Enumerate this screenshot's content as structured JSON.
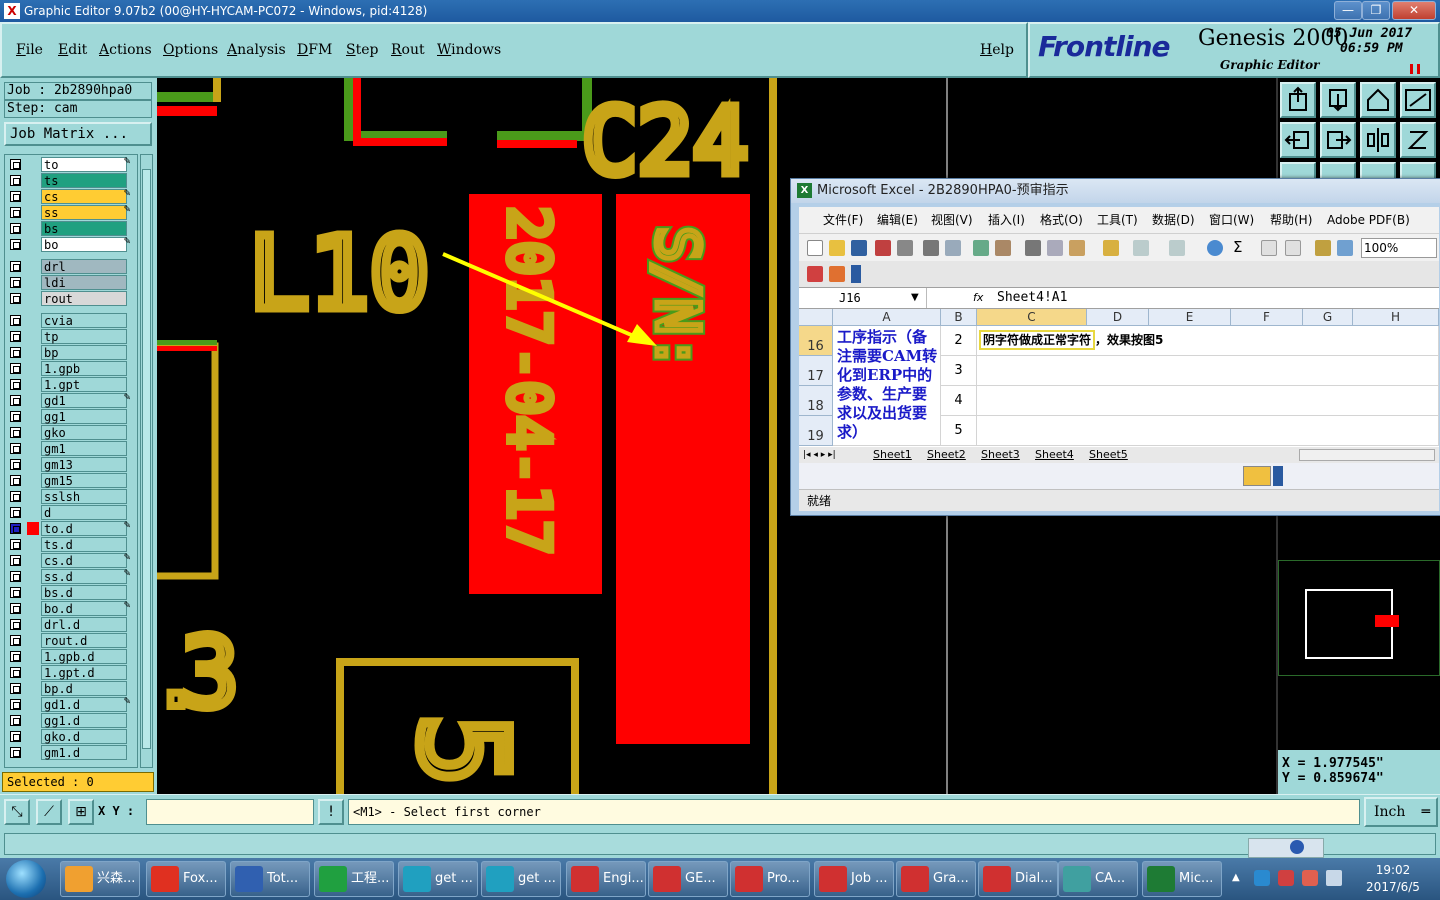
{
  "window": {
    "title": "Graphic Editor 9.07b2 (00@HY-HYCAM-PC072 - Windows, pid:4128)",
    "minimize": "—",
    "maximize": "❐",
    "close": "✕"
  },
  "menu": {
    "items": [
      "File",
      "Edit",
      "Actions",
      "Options",
      "Analysis",
      "DFM",
      "Step",
      "Rout",
      "Windows"
    ],
    "help": "Help"
  },
  "brand": {
    "logo": "Frontline",
    "product": "Genesis 2000",
    "module": "Graphic Editor",
    "date": "05 Jun 2017",
    "time": "06:59 PM"
  },
  "left": {
    "job": "Job : 2b2890hpa0",
    "step": "Step: cam",
    "job_matrix": "Job Matrix ...",
    "selected": "Selected : 0",
    "layers": [
      {
        "name": "to",
        "bg": "#ffffff",
        "lock": true
      },
      {
        "name": "ts",
        "bg": "#20a080",
        "lock": false
      },
      {
        "name": "cs",
        "bg": "#ffcc33",
        "lock": true
      },
      {
        "name": "ss",
        "bg": "#ffcc33",
        "lock": true
      },
      {
        "name": "bs",
        "bg": "#20a080",
        "lock": false
      },
      {
        "name": "bo",
        "bg": "#ffffff",
        "lock": true
      },
      {
        "name": "drl",
        "bg": "#a0b8c0",
        "lock": false,
        "gap": true
      },
      {
        "name": "ldi",
        "bg": "#a0b8c0",
        "lock": false
      },
      {
        "name": "rout",
        "bg": "#d8d8d8",
        "lock": false
      },
      {
        "name": "cvia",
        "bg": "#9fd8d8",
        "lock": false,
        "gap": true
      },
      {
        "name": "tp",
        "bg": "#9fd8d8",
        "lock": false
      },
      {
        "name": "bp",
        "bg": "#9fd8d8",
        "lock": false
      },
      {
        "name": "1.gpb",
        "bg": "#9fd8d8",
        "lock": false
      },
      {
        "name": "1.gpt",
        "bg": "#9fd8d8",
        "lock": false
      },
      {
        "name": "gd1",
        "bg": "#9fd8d8",
        "lock": true
      },
      {
        "name": "gg1",
        "bg": "#9fd8d8",
        "lock": false
      },
      {
        "name": "gko",
        "bg": "#9fd8d8",
        "lock": false
      },
      {
        "name": "gm1",
        "bg": "#9fd8d8",
        "lock": false
      },
      {
        "name": "gm13",
        "bg": "#9fd8d8",
        "lock": false
      },
      {
        "name": "gm15",
        "bg": "#9fd8d8",
        "lock": false
      },
      {
        "name": "sslsh",
        "bg": "#9fd8d8",
        "lock": false
      },
      {
        "name": "d",
        "bg": "#9fd8d8",
        "lock": false
      },
      {
        "name": "to.d",
        "bg": "#9fd8d8",
        "lock": true,
        "active": true
      },
      {
        "name": "ts.d",
        "bg": "#9fd8d8",
        "lock": false
      },
      {
        "name": "cs.d",
        "bg": "#9fd8d8",
        "lock": true
      },
      {
        "name": "ss.d",
        "bg": "#9fd8d8",
        "lock": true
      },
      {
        "name": "bs.d",
        "bg": "#9fd8d8",
        "lock": false
      },
      {
        "name": "bo.d",
        "bg": "#9fd8d8",
        "lock": true
      },
      {
        "name": "drl.d",
        "bg": "#9fd8d8",
        "lock": false
      },
      {
        "name": "rout.d",
        "bg": "#9fd8d8",
        "lock": false
      },
      {
        "name": "1.gpb.d",
        "bg": "#9fd8d8",
        "lock": false
      },
      {
        "name": "1.gpt.d",
        "bg": "#9fd8d8",
        "lock": false
      },
      {
        "name": "bp.d",
        "bg": "#9fd8d8",
        "lock": false
      },
      {
        "name": "gd1.d",
        "bg": "#9fd8d8",
        "lock": true
      },
      {
        "name": "gg1.d",
        "bg": "#9fd8d8",
        "lock": false
      },
      {
        "name": "gko.d",
        "bg": "#9fd8d8",
        "lock": false
      },
      {
        "name": "gm1.d",
        "bg": "#9fd8d8",
        "lock": false
      }
    ]
  },
  "canvas": {
    "labels": {
      "c24": "C24",
      "l10": "L10",
      "date_text": "2017-04-17",
      "sn": "S/N:",
      "three": "3",
      "five": "5"
    },
    "colors": {
      "silk": "#c8a418",
      "pad": "#ff0000",
      "green": "#4a9a1a",
      "arrow": "#ffff00"
    }
  },
  "coords": {
    "x": "X = 1.977545\"",
    "y": "Y = 0.859674\""
  },
  "bottom": {
    "xy_label": "X Y :",
    "xy_value": "",
    "message": "<M1> - Select first corner",
    "unit": "Inch"
  },
  "excel": {
    "title": "Microsoft Excel - 2B2890HPA0-预审指示",
    "menu": [
      "文件(F)",
      "编辑(E)",
      "视图(V)",
      "插入(I)",
      "格式(O)",
      "工具(T)",
      "数据(D)",
      "窗口(W)",
      "帮助(H)",
      "Adobe PDF(B)"
    ],
    "zoom": "100%",
    "name_box": "J16",
    "fx": "fx",
    "formula": "Sheet4!A1",
    "columns": [
      "A",
      "B",
      "C",
      "D",
      "E",
      "F",
      "G",
      "H"
    ],
    "rows": [
      "16",
      "17",
      "18",
      "19"
    ],
    "a_text": "工序指示（备注需要CAM转化到ERP中的参数、生产要求以及出货要求）",
    "b_values": [
      "2",
      "3",
      "4",
      "5"
    ],
    "c16_highlight": "阴字符做成正常字符",
    "c16_rest": "，效果按图5",
    "sheets": [
      "Sheet1",
      "Sheet2",
      "Sheet3",
      "Sheet4",
      "Sheet5"
    ],
    "status": "就绪"
  },
  "taskbar": {
    "items": [
      "兴森...",
      "Fox...",
      "Tot...",
      "工程...",
      "get ...",
      "get ...",
      "Engi...",
      "GE...",
      "Pro...",
      "Job ...",
      "Gra...",
      "Dial...",
      "CA...",
      "Mic..."
    ],
    "time": "19:02",
    "date": "2017/6/5"
  }
}
